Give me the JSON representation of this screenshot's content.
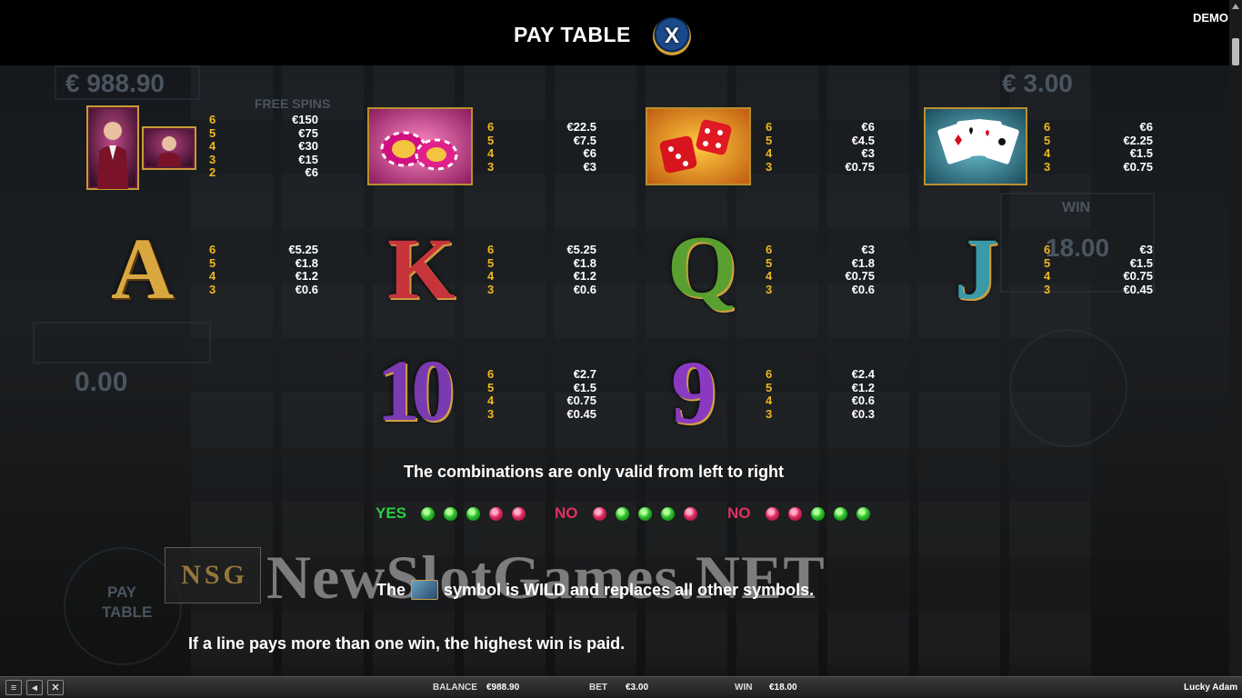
{
  "header": {
    "title": "PAY TABLE",
    "close_label": "X",
    "mode": "DEMO"
  },
  "symbols": {
    "lucky_adam": {
      "counts": [
        "6",
        "5",
        "4",
        "3",
        "2"
      ],
      "values": [
        "€150",
        "€75",
        "€30",
        "€15",
        "€6"
      ]
    },
    "chips": {
      "counts": [
        "6",
        "5",
        "4",
        "3"
      ],
      "values": [
        "€22.5",
        "€7.5",
        "€6",
        "€3"
      ]
    },
    "dice": {
      "counts": [
        "6",
        "5",
        "4",
        "3"
      ],
      "values": [
        "€6",
        "€4.5",
        "€3",
        "€0.75"
      ]
    },
    "cards": {
      "counts": [
        "6",
        "5",
        "4",
        "3"
      ],
      "values": [
        "€6",
        "€2.25",
        "€1.5",
        "€0.75"
      ]
    },
    "A": {
      "glyph": "A",
      "counts": [
        "6",
        "5",
        "4",
        "3"
      ],
      "values": [
        "€5.25",
        "€1.8",
        "€1.2",
        "€0.6"
      ]
    },
    "K": {
      "glyph": "K",
      "counts": [
        "6",
        "5",
        "4",
        "3"
      ],
      "values": [
        "€5.25",
        "€1.8",
        "€1.2",
        "€0.6"
      ]
    },
    "Q": {
      "glyph": "Q",
      "counts": [
        "6",
        "5",
        "4",
        "3"
      ],
      "values": [
        "€3",
        "€1.8",
        "€0.75",
        "€0.6"
      ]
    },
    "J": {
      "glyph": "J",
      "counts": [
        "6",
        "5",
        "4",
        "3"
      ],
      "values": [
        "€3",
        "€1.5",
        "€0.75",
        "€0.45"
      ]
    },
    "ten": {
      "glyph": "10",
      "counts": [
        "6",
        "5",
        "4",
        "3"
      ],
      "values": [
        "€2.7",
        "€1.5",
        "€0.75",
        "€0.45"
      ]
    },
    "nine": {
      "glyph": "9",
      "counts": [
        "6",
        "5",
        "4",
        "3"
      ],
      "values": [
        "€2.4",
        "€1.2",
        "€0.6",
        "€0.3"
      ]
    }
  },
  "rules": {
    "direction": "The combinations are only valid from left to right",
    "yes": "YES",
    "no": "NO",
    "examples": [
      {
        "label": "YES",
        "dots": [
          "g",
          "g",
          "g",
          "r",
          "r"
        ]
      },
      {
        "label": "NO",
        "dots": [
          "r",
          "g",
          "g",
          "g",
          "r"
        ]
      },
      {
        "label": "NO",
        "dots": [
          "r",
          "r",
          "g",
          "g",
          "g"
        ]
      }
    ],
    "wild_pre": "The",
    "wild_post": "symbol is WILD and replaces all other symbols.",
    "highest": "If a line pays more than one win, the highest win is paid."
  },
  "watermark": {
    "logo": [
      "N",
      "S",
      "G"
    ],
    "text": "NewSlotGames.NET"
  },
  "background": {
    "balance_ghost": "€ 988.90",
    "bet_ghost": "€ 3.00",
    "free_spins": "FREE SPINS",
    "win_ghost": "WIN",
    "win_val": "18.00",
    "zero": "0.00",
    "pay_ghost": "PAY",
    "table_ghost": "TABLE"
  },
  "footer": {
    "balance_label": "BALANCE",
    "balance": "€988.90",
    "bet_label": "BET",
    "bet": "€3.00",
    "win_label": "WIN",
    "win": "€18.00",
    "game_name": "Lucky Adam"
  },
  "colors": {
    "gold": "#f0b71f",
    "yes": "#2ecc40",
    "no": "#e03060"
  }
}
